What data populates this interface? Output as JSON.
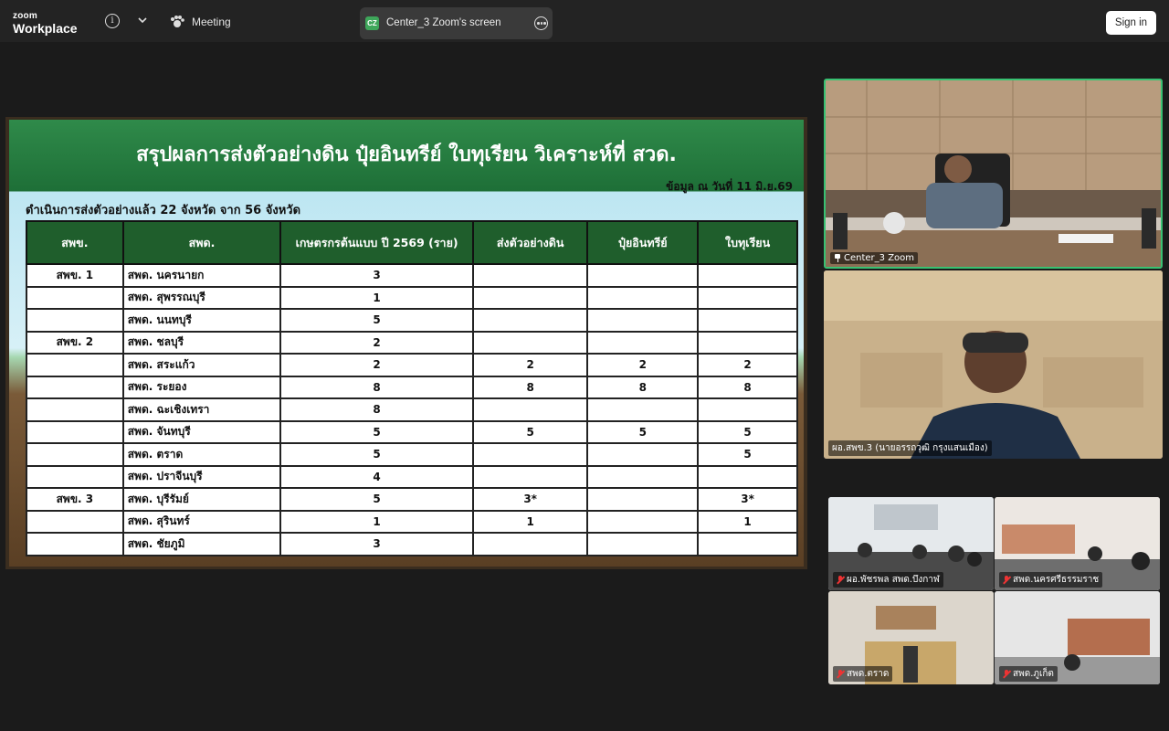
{
  "app": {
    "brand_top": "zoom",
    "brand_bottom": "Workplace",
    "meeting_label": "Meeting",
    "screen_badge": "CZ",
    "screen_label": "Center_3 Zoom's screen",
    "signin_label": "Sign in"
  },
  "slide": {
    "title": "สรุปผลการส่งตัวอย่างดิน ปุ๋ยอินทรีย์ ใบทุเรียน วิเคราะห์ที่ สวด.",
    "date_note": "ข้อมูล ณ วันที่ 11 มิ.ย.69",
    "subtitle": "ดำเนินการส่งตัวอย่างแล้ว  22 จังหวัด จาก 56 จังหวัด",
    "headers": [
      "สพข.",
      "สพด.",
      "เกษตรกรต้นแบบ ปี 2569 (ราย)",
      "ส่งตัวอย่างดิน",
      "ปุ๋ยอินทรีย์",
      "ใบทุเรียน"
    ],
    "rows": [
      [
        "สพข. 1",
        "สพด. นครนายก",
        "3",
        "",
        "",
        ""
      ],
      [
        "",
        "สพด. สุพรรณบุรี",
        "1",
        "",
        "",
        ""
      ],
      [
        "",
        "สพด. นนทบุรี",
        "5",
        "",
        "",
        ""
      ],
      [
        "สพข. 2",
        "สพด. ชลบุรี",
        "2",
        "",
        "",
        ""
      ],
      [
        "",
        "สพด. สระแก้ว",
        "2",
        "2",
        "2",
        "2"
      ],
      [
        "",
        "สพด. ระยอง",
        "8",
        "8",
        "8",
        "8"
      ],
      [
        "",
        "สพด. ฉะเชิงเทรา",
        "8",
        "",
        "",
        ""
      ],
      [
        "",
        "สพด. จันทบุรี",
        "5",
        "5",
        "5",
        "5"
      ],
      [
        "",
        "สพด. ตราด",
        "5",
        "",
        "",
        "5"
      ],
      [
        "",
        "สพด. ปราจีนบุรี",
        "4",
        "",
        "",
        ""
      ],
      [
        "สพข. 3",
        "สพด. บุรีรัมย์",
        "5",
        "3*",
        "",
        "3*"
      ],
      [
        "",
        "สพด. สุรินทร์",
        "1",
        "1",
        "",
        "1"
      ],
      [
        "",
        "สพด. ชัยภูมิ",
        "3",
        "",
        "",
        ""
      ]
    ]
  },
  "tiles": {
    "active_speaker": "Center_3 Zoom",
    "second": "ผอ.สพข.3 (นายอรรถวุฒิ กรุงแสนเมือง)",
    "grid": [
      "ผอ.พัชรพล สพด.บึงกาฬ",
      "สพด.นครศรีธรรมราช",
      "สพด.ตราด",
      "สพด.ภูเก็ต"
    ]
  }
}
